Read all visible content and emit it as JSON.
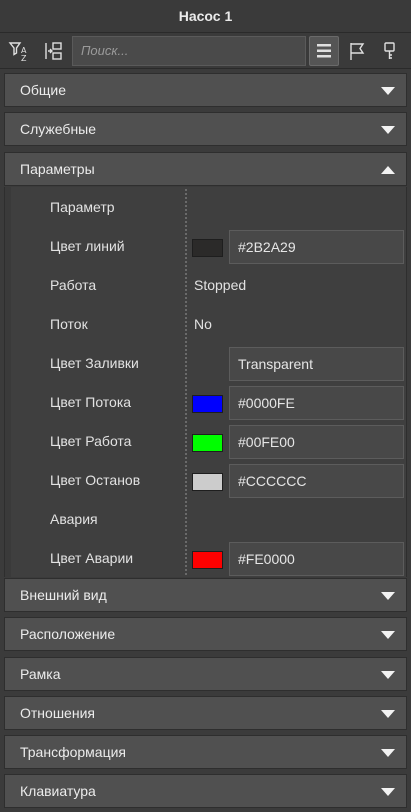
{
  "window": {
    "title": "Насос 1"
  },
  "toolbar": {
    "search_placeholder": "Поиск..."
  },
  "sections": [
    {
      "label": "Общие",
      "state": "collapsed"
    },
    {
      "label": "Служебные",
      "state": "collapsed"
    },
    {
      "label": "Параметры",
      "state": "expanded"
    },
    {
      "label": "Внешний вид",
      "state": "collapsed"
    },
    {
      "label": "Расположение",
      "state": "collapsed"
    },
    {
      "label": "Рамка",
      "state": "collapsed"
    },
    {
      "label": "Отношения",
      "state": "collapsed"
    },
    {
      "label": "Трансформация",
      "state": "collapsed"
    },
    {
      "label": "Клавиатура",
      "state": "collapsed"
    }
  ],
  "properties": [
    {
      "label": "Параметр"
    },
    {
      "label": "Цвет линий",
      "value": "#2B2A29",
      "swatch": "#2B2A29"
    },
    {
      "label": "Работа",
      "value": "Stopped"
    },
    {
      "label": "Поток",
      "value": "No"
    },
    {
      "label": "Цвет Заливки",
      "value": "Transparent"
    },
    {
      "label": "Цвет Потока",
      "value": "#0000FE",
      "swatch": "#0000FE"
    },
    {
      "label": "Цвет Работа",
      "value": "#00FE00",
      "swatch": "#00FE00"
    },
    {
      "label": "Цвет Останов",
      "value": "#CCCCCC",
      "swatch": "#CCCCCC"
    },
    {
      "label": "Авария"
    },
    {
      "label": "Цвет Аварии",
      "value": "#FE0000",
      "swatch": "#FE0000"
    }
  ],
  "icons": {
    "toolbar": [
      "sort-az-filter-icon",
      "collapse-tree-icon",
      "list-view-icon",
      "flag-icon",
      "key-icon"
    ],
    "section_collapsed": "chevron-down-icon",
    "section_expanded": "chevron-up-icon"
  }
}
